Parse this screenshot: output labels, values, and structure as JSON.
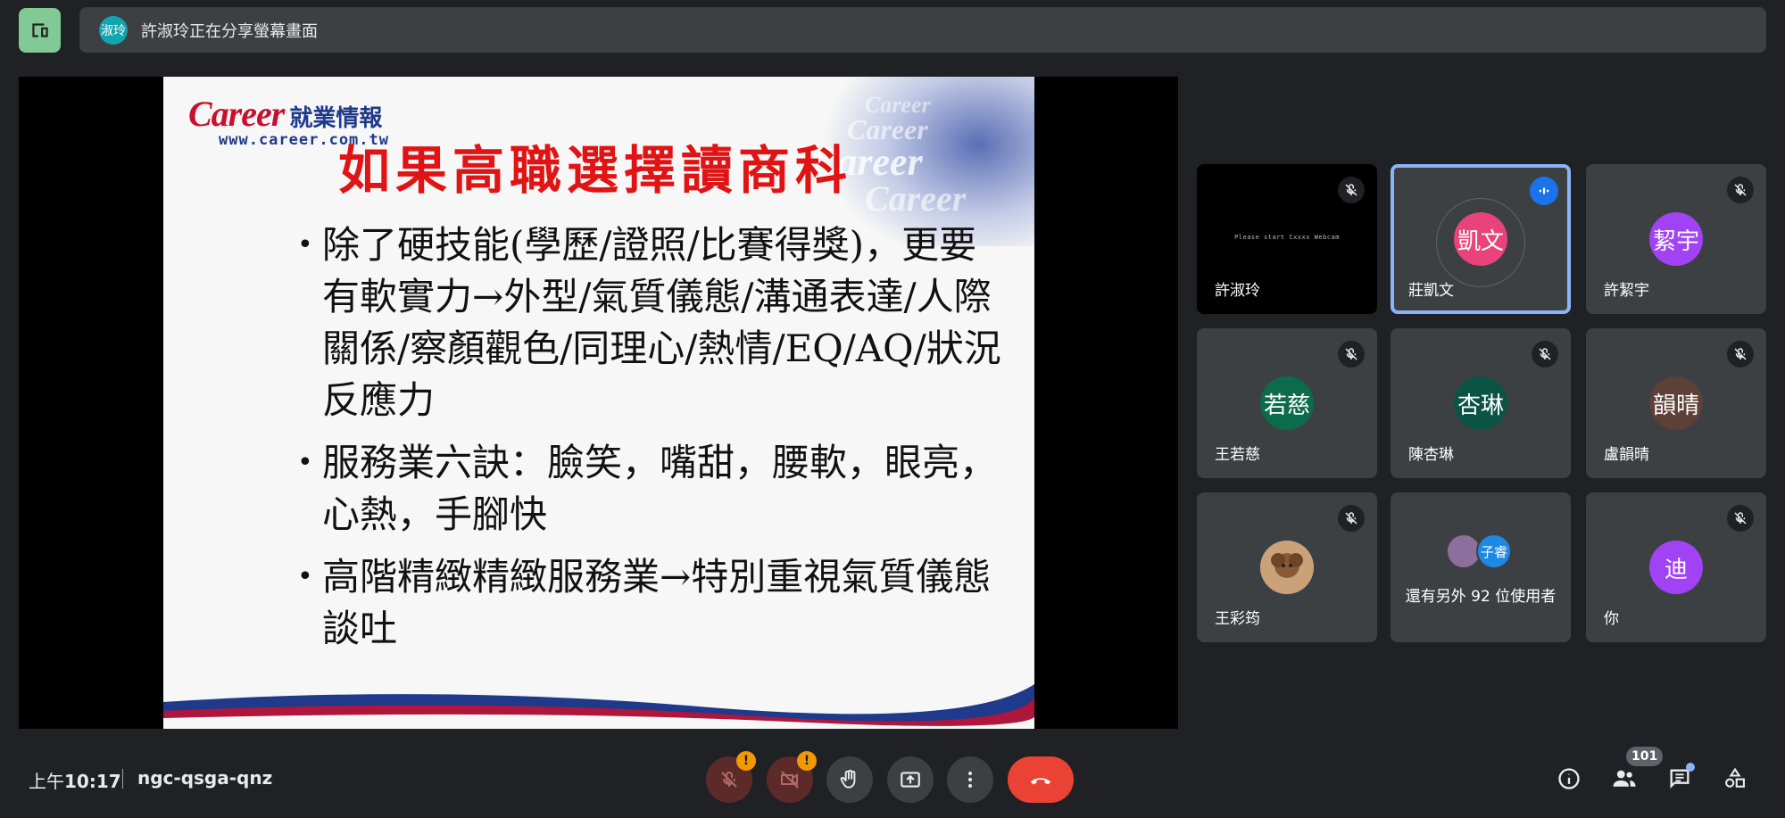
{
  "header": {
    "presenter_avatar": "淑玲",
    "presenting_text": "許淑玲正在分享螢幕畫面",
    "layout_icon": "present-to-all-icon"
  },
  "slide": {
    "brand": "Career",
    "brand_cn": "就業情報",
    "site": "www.career.com.tw",
    "title": "如果高職選擇讀商科",
    "bullets": [
      "除了硬技能(學歷/證照/比賽得獎)，更要有軟實力→外型/氣質儀態/溝通表達/人際關係/察顏觀色/同理心/熱情/EQ/AQ/狀況反應力",
      "服務業六訣：臉笑，嘴甜，腰軟，眼亮，心熱，手腳快",
      "高階精緻精緻服務業→特別重視氣質儀態談吐"
    ]
  },
  "participants": [
    {
      "name": "許淑玲",
      "avatar": "",
      "webcam_text": "Please start Cxxxx Webcam",
      "muted": true
    },
    {
      "name": "莊凱文",
      "avatar": "凱文",
      "avatar_color": "#e8437a",
      "speaking": true
    },
    {
      "name": "許絜宇",
      "avatar": "絜宇",
      "avatar_color": "#a142f4",
      "muted": true
    },
    {
      "name": "王若慈",
      "avatar": "若慈",
      "avatar_color": "#0b6b4a",
      "muted": true
    },
    {
      "name": "陳杏琳",
      "avatar": "杏琳",
      "avatar_color": "#0b5345",
      "muted": true
    },
    {
      "name": "盧韻晴",
      "avatar": "韻晴",
      "avatar_color": "#5d4037",
      "muted": true
    },
    {
      "name": "王彩筠",
      "avatar": "",
      "muted": true
    },
    {
      "name": "",
      "avatar": "子睿",
      "more_text": "還有另外 92 位使用者"
    },
    {
      "name": "你",
      "avatar": "迪",
      "avatar_color": "#a142f4",
      "muted": true
    }
  ],
  "footer": {
    "time_prefix": "上午",
    "time": "10:17",
    "meeting_code": "ngc-qsga-qnz",
    "participant_count": "101",
    "warn_glyph": "!"
  }
}
